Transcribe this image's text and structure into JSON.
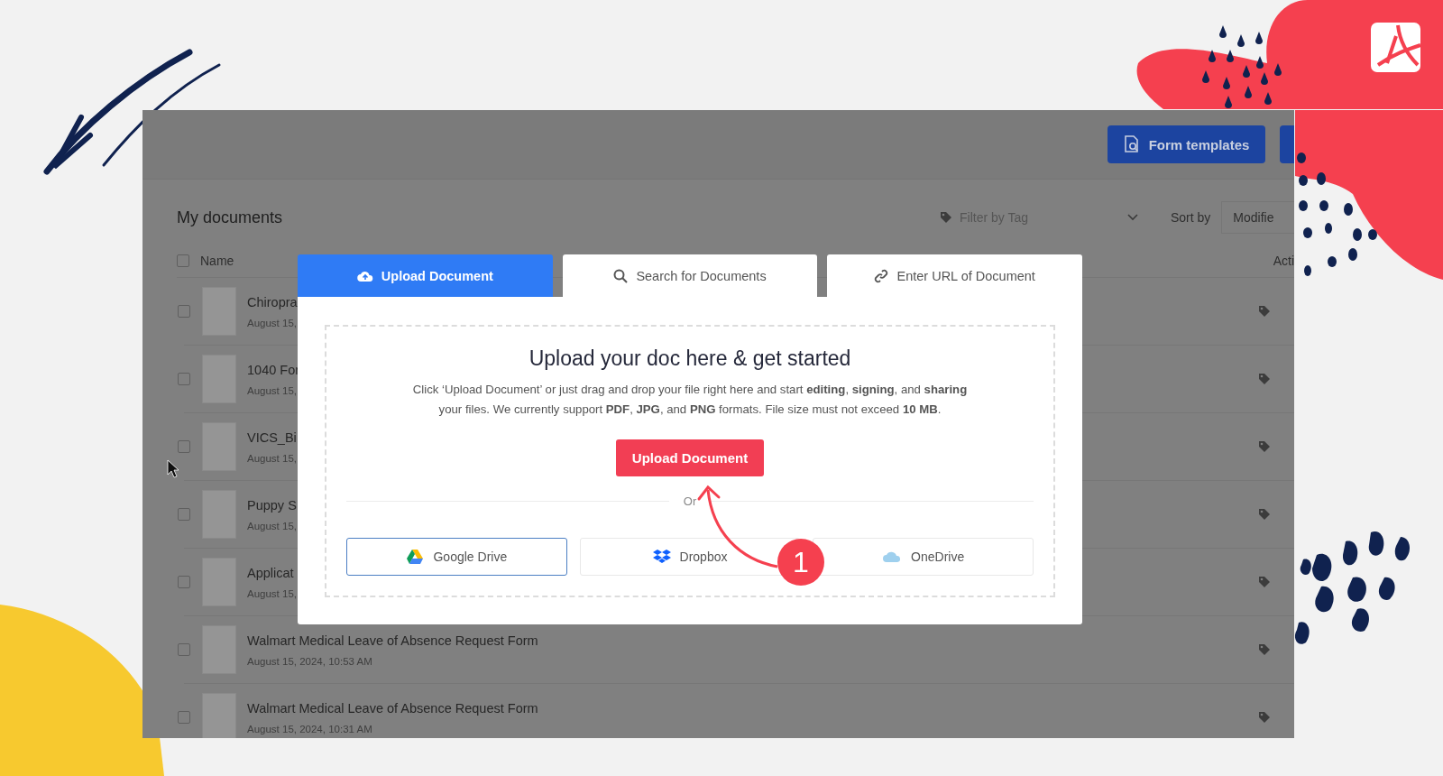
{
  "header": {
    "buttons": [
      {
        "label": "Form templates"
      }
    ]
  },
  "documents": {
    "title": "My documents",
    "filter": {
      "placeholder": "Filter by Tag"
    },
    "sort": {
      "label": "Sort by",
      "value": "Modifie"
    },
    "select_all": {
      "checked": false
    },
    "columns": [
      "Name",
      "Acti"
    ],
    "rows": [
      {
        "name": "Chiropra",
        "date": "August 15,",
        "checked": false
      },
      {
        "name": "1040 For",
        "date": "August 15,",
        "checked": false
      },
      {
        "name": "VICS_Bi",
        "date": "August 15,",
        "checked": false
      },
      {
        "name": "Puppy S",
        "date": "August 15,",
        "checked": false
      },
      {
        "name": "Applicat",
        "date": "August 15,",
        "checked": false
      },
      {
        "name": "Walmart Medical Leave of Absence Request Form",
        "date": "August 15, 2024, 10:53 AM",
        "checked": false
      },
      {
        "name": "Walmart Medical Leave of Absence Request Form",
        "date": "August 15, 2024, 10:31 AM",
        "checked": false
      }
    ]
  },
  "modal": {
    "tabs": [
      {
        "kind": "upload",
        "label": "Upload Document",
        "selected": true
      },
      {
        "kind": "search",
        "label": "Search for Documents",
        "selected": false
      },
      {
        "kind": "link",
        "label": "Enter URL of Document",
        "selected": false
      }
    ],
    "title": "Upload your doc here & get started",
    "description": "Click ‘Upload Document’ or just drag and drop your file right here and start **editing**, **signing**, and **sharing** your files. We currently support **PDF**, **JPG**, and **PNG** formats. File size must not exceed **10 MB**.",
    "upload_button": "Upload Document",
    "divider": "Or",
    "sources": [
      {
        "kind": "google",
        "label": "Google Drive",
        "selected": true
      },
      {
        "kind": "dropbox",
        "label": "Dropbox",
        "selected": false
      },
      {
        "kind": "onedrive",
        "label": "OneDrive",
        "selected": false
      }
    ]
  },
  "annotation": {
    "step": "1"
  }
}
